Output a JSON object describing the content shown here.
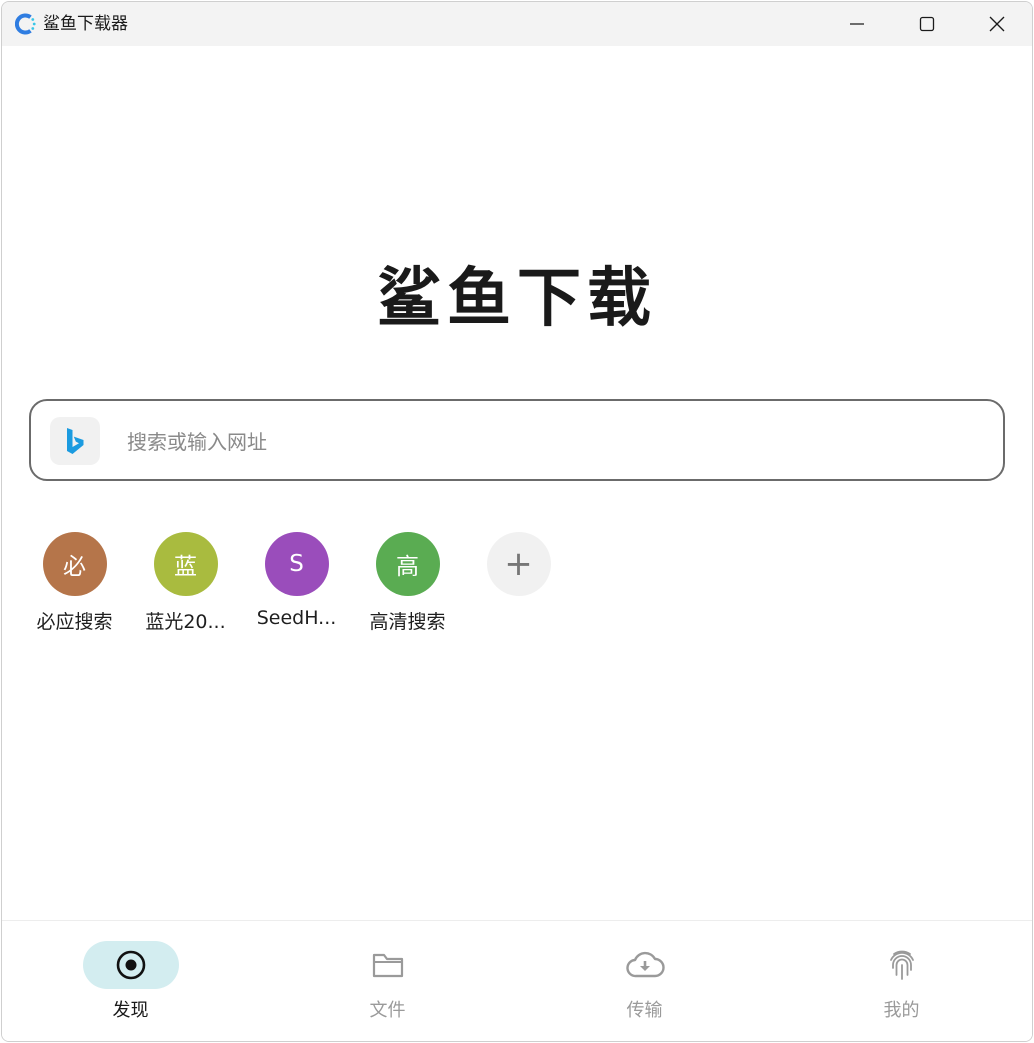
{
  "window": {
    "title": "鲨鱼下载器"
  },
  "hero": {
    "title": "鲨鱼下载"
  },
  "search": {
    "engine_icon": "bing-icon",
    "placeholder": "搜索或输入网址",
    "value": ""
  },
  "shortcuts": [
    {
      "letter": "必",
      "label": "必应搜索",
      "color": "#b5754a"
    },
    {
      "letter": "蓝",
      "label": "蓝光20...",
      "color": "#a9bb3f"
    },
    {
      "letter": "S",
      "label": "SeedH...",
      "color": "#9a4dbb"
    },
    {
      "letter": "高",
      "label": "高清搜索",
      "color": "#5aac52"
    },
    {
      "letter": "+",
      "label": "",
      "color": "#f1f1f1"
    }
  ],
  "nav": [
    {
      "label": "发现",
      "icon": "discover-icon",
      "active": true
    },
    {
      "label": "文件",
      "icon": "folder-icon",
      "active": false
    },
    {
      "label": "传输",
      "icon": "cloud-download-icon",
      "active": false
    },
    {
      "label": "我的",
      "icon": "fingerprint-icon",
      "active": false
    }
  ]
}
